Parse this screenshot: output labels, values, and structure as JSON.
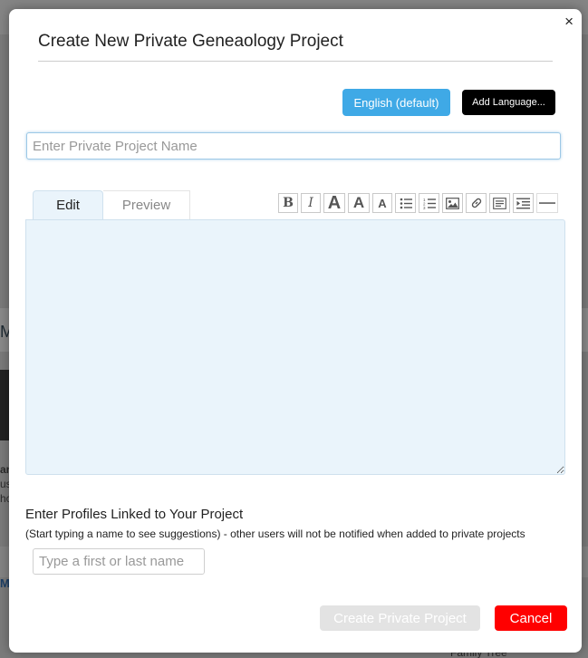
{
  "dialog": {
    "title": "Create New Private Geneaology Project",
    "close_symbol": "×",
    "languages": {
      "default_label": "English (default)",
      "add_label": "Add Language..."
    },
    "project_name": {
      "placeholder": "Enter Private Project Name",
      "value": ""
    },
    "editor": {
      "tabs": [
        {
          "label": "Edit",
          "active": true
        },
        {
          "label": "Preview",
          "active": false
        }
      ],
      "toolbar_icons": [
        "bold-icon",
        "italic-icon",
        "font-large-icon",
        "font-medium-icon",
        "font-small-icon",
        "bulleted-list-icon",
        "numbered-list-icon",
        "image-icon",
        "link-icon",
        "blockquote-icon",
        "indent-icon",
        "horizontal-rule-icon"
      ],
      "content": ""
    },
    "profiles": {
      "label": "Enter Profiles Linked to Your Project",
      "hint": "(Start typing a name to see suggestions) - other users will not be notified when added to private projects",
      "placeholder": "Type a first or last name"
    },
    "actions": {
      "create_label": "Create Private Project",
      "cancel_label": "Cancel"
    }
  },
  "background": {
    "fragments": [
      "Ma",
      "an",
      "us",
      "ho",
      "M",
      "Family Tree"
    ]
  },
  "colors": {
    "primary_blue": "#3fa9e6",
    "cancel_red": "#ff0000",
    "editor_bg": "#eaf4fb",
    "disabled_gray": "#e3e3e3"
  }
}
